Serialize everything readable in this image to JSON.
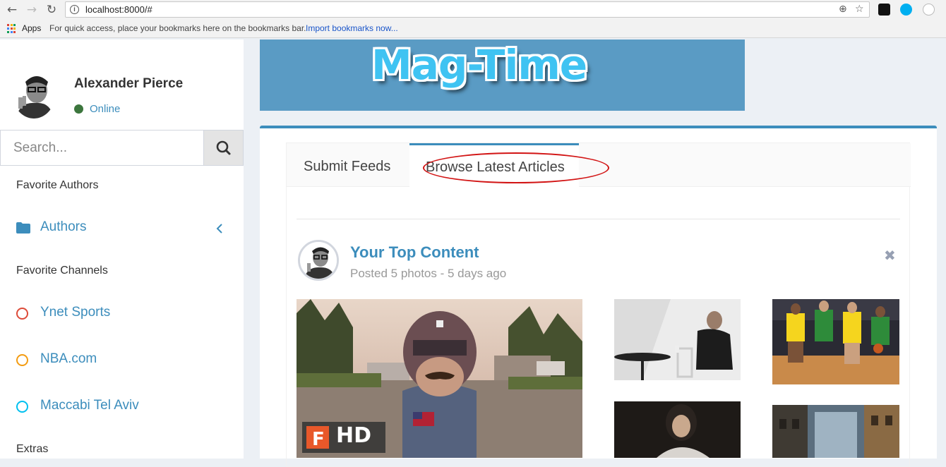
{
  "browser": {
    "url": "localhost:8000/#",
    "bookmarks_apps": "Apps",
    "bookmarks_hint": "For quick access, place your bookmarks here on the bookmarks bar.",
    "bookmarks_import": "Import bookmarks now..."
  },
  "sidebar": {
    "user_name": "Alexander Pierce",
    "status": "Online",
    "search_placeholder": "Search...",
    "favorite_authors_header": "Favorite Authors",
    "authors_label": "Authors",
    "favorite_channels_header": "Favorite Channels",
    "channels": [
      {
        "label": "Ynet Sports",
        "color": "#dd4b39"
      },
      {
        "label": "NBA.com",
        "color": "#f39c12"
      },
      {
        "label": "Maccabi Tel Aviv",
        "color": "#00c0ef"
      }
    ],
    "extras_header": "Extras"
  },
  "banner": {
    "logo_text": "Mag-Time"
  },
  "tabs": {
    "submit": "Submit Feeds",
    "browse": "Browse Latest Articles"
  },
  "post": {
    "title": "Your Top Content",
    "subtitle": "Posted 5 photos - 5 days ago",
    "video_badge": "HD"
  },
  "colors": {
    "accent": "#3c8dbc",
    "online": "#3c763d",
    "highlight_ellipse": "#d21414"
  }
}
